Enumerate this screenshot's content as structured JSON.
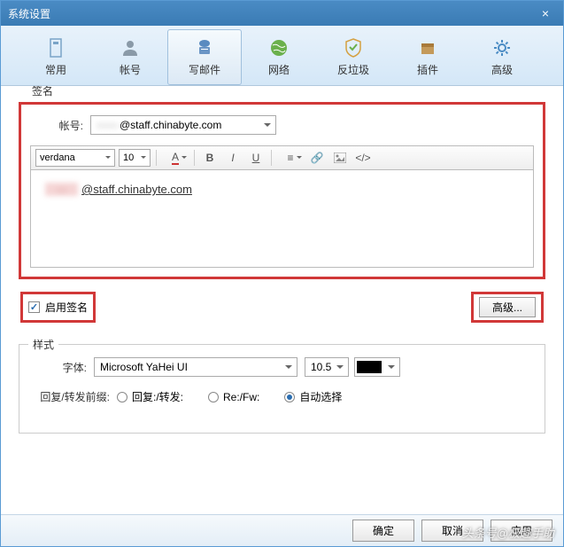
{
  "window": {
    "title": "系统设置"
  },
  "toolbar": {
    "items": [
      {
        "label": "常用"
      },
      {
        "label": "帐号"
      },
      {
        "label": "写邮件"
      },
      {
        "label": "网络"
      },
      {
        "label": "反垃圾"
      },
      {
        "label": "插件"
      },
      {
        "label": "高级"
      }
    ],
    "active_index": 2
  },
  "signature": {
    "legend": "签名",
    "account_label": "帐号:",
    "account_value": "@staff.chinabyte.com",
    "editor": {
      "font": "verdana",
      "size": "10",
      "content_email": "@staff.chinabyte.com"
    },
    "enable_label": "启用签名",
    "enable_checked": true,
    "advanced_btn": "高级..."
  },
  "style": {
    "legend": "样式",
    "font_label": "字体:",
    "font_value": "Microsoft YaHei UI",
    "font_size": "10.5",
    "reply_label": "回复/转发前缀:",
    "options": [
      {
        "label": "回复:/转发:",
        "checked": false
      },
      {
        "label": "Re:/Fw:",
        "checked": false
      },
      {
        "label": "自动选择",
        "checked": true
      }
    ]
  },
  "footer": {
    "ok": "确定",
    "cancel": "取消",
    "apply": "应用"
  },
  "watermark": "头条号@极趣手助"
}
